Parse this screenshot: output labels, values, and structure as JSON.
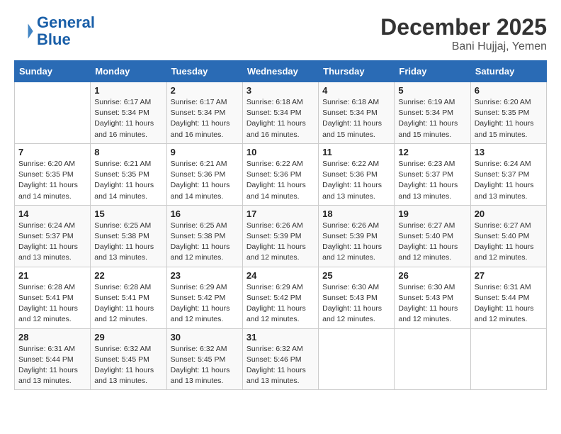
{
  "header": {
    "logo_line1": "General",
    "logo_line2": "Blue",
    "month": "December 2025",
    "location": "Bani Hujjaj, Yemen"
  },
  "days_of_week": [
    "Sunday",
    "Monday",
    "Tuesday",
    "Wednesday",
    "Thursday",
    "Friday",
    "Saturday"
  ],
  "weeks": [
    [
      {
        "day": "",
        "info": ""
      },
      {
        "day": "1",
        "info": "Sunrise: 6:17 AM\nSunset: 5:34 PM\nDaylight: 11 hours and 16 minutes."
      },
      {
        "day": "2",
        "info": "Sunrise: 6:17 AM\nSunset: 5:34 PM\nDaylight: 11 hours and 16 minutes."
      },
      {
        "day": "3",
        "info": "Sunrise: 6:18 AM\nSunset: 5:34 PM\nDaylight: 11 hours and 16 minutes."
      },
      {
        "day": "4",
        "info": "Sunrise: 6:18 AM\nSunset: 5:34 PM\nDaylight: 11 hours and 15 minutes."
      },
      {
        "day": "5",
        "info": "Sunrise: 6:19 AM\nSunset: 5:34 PM\nDaylight: 11 hours and 15 minutes."
      },
      {
        "day": "6",
        "info": "Sunrise: 6:20 AM\nSunset: 5:35 PM\nDaylight: 11 hours and 15 minutes."
      }
    ],
    [
      {
        "day": "7",
        "info": "Sunrise: 6:20 AM\nSunset: 5:35 PM\nDaylight: 11 hours and 14 minutes."
      },
      {
        "day": "8",
        "info": "Sunrise: 6:21 AM\nSunset: 5:35 PM\nDaylight: 11 hours and 14 minutes."
      },
      {
        "day": "9",
        "info": "Sunrise: 6:21 AM\nSunset: 5:36 PM\nDaylight: 11 hours and 14 minutes."
      },
      {
        "day": "10",
        "info": "Sunrise: 6:22 AM\nSunset: 5:36 PM\nDaylight: 11 hours and 14 minutes."
      },
      {
        "day": "11",
        "info": "Sunrise: 6:22 AM\nSunset: 5:36 PM\nDaylight: 11 hours and 13 minutes."
      },
      {
        "day": "12",
        "info": "Sunrise: 6:23 AM\nSunset: 5:37 PM\nDaylight: 11 hours and 13 minutes."
      },
      {
        "day": "13",
        "info": "Sunrise: 6:24 AM\nSunset: 5:37 PM\nDaylight: 11 hours and 13 minutes."
      }
    ],
    [
      {
        "day": "14",
        "info": "Sunrise: 6:24 AM\nSunset: 5:37 PM\nDaylight: 11 hours and 13 minutes."
      },
      {
        "day": "15",
        "info": "Sunrise: 6:25 AM\nSunset: 5:38 PM\nDaylight: 11 hours and 13 minutes."
      },
      {
        "day": "16",
        "info": "Sunrise: 6:25 AM\nSunset: 5:38 PM\nDaylight: 11 hours and 12 minutes."
      },
      {
        "day": "17",
        "info": "Sunrise: 6:26 AM\nSunset: 5:39 PM\nDaylight: 11 hours and 12 minutes."
      },
      {
        "day": "18",
        "info": "Sunrise: 6:26 AM\nSunset: 5:39 PM\nDaylight: 11 hours and 12 minutes."
      },
      {
        "day": "19",
        "info": "Sunrise: 6:27 AM\nSunset: 5:40 PM\nDaylight: 11 hours and 12 minutes."
      },
      {
        "day": "20",
        "info": "Sunrise: 6:27 AM\nSunset: 5:40 PM\nDaylight: 11 hours and 12 minutes."
      }
    ],
    [
      {
        "day": "21",
        "info": "Sunrise: 6:28 AM\nSunset: 5:41 PM\nDaylight: 11 hours and 12 minutes."
      },
      {
        "day": "22",
        "info": "Sunrise: 6:28 AM\nSunset: 5:41 PM\nDaylight: 11 hours and 12 minutes."
      },
      {
        "day": "23",
        "info": "Sunrise: 6:29 AM\nSunset: 5:42 PM\nDaylight: 11 hours and 12 minutes."
      },
      {
        "day": "24",
        "info": "Sunrise: 6:29 AM\nSunset: 5:42 PM\nDaylight: 11 hours and 12 minutes."
      },
      {
        "day": "25",
        "info": "Sunrise: 6:30 AM\nSunset: 5:43 PM\nDaylight: 11 hours and 12 minutes."
      },
      {
        "day": "26",
        "info": "Sunrise: 6:30 AM\nSunset: 5:43 PM\nDaylight: 11 hours and 12 minutes."
      },
      {
        "day": "27",
        "info": "Sunrise: 6:31 AM\nSunset: 5:44 PM\nDaylight: 11 hours and 12 minutes."
      }
    ],
    [
      {
        "day": "28",
        "info": "Sunrise: 6:31 AM\nSunset: 5:44 PM\nDaylight: 11 hours and 13 minutes."
      },
      {
        "day": "29",
        "info": "Sunrise: 6:32 AM\nSunset: 5:45 PM\nDaylight: 11 hours and 13 minutes."
      },
      {
        "day": "30",
        "info": "Sunrise: 6:32 AM\nSunset: 5:45 PM\nDaylight: 11 hours and 13 minutes."
      },
      {
        "day": "31",
        "info": "Sunrise: 6:32 AM\nSunset: 5:46 PM\nDaylight: 11 hours and 13 minutes."
      },
      {
        "day": "",
        "info": ""
      },
      {
        "day": "",
        "info": ""
      },
      {
        "day": "",
        "info": ""
      }
    ]
  ]
}
